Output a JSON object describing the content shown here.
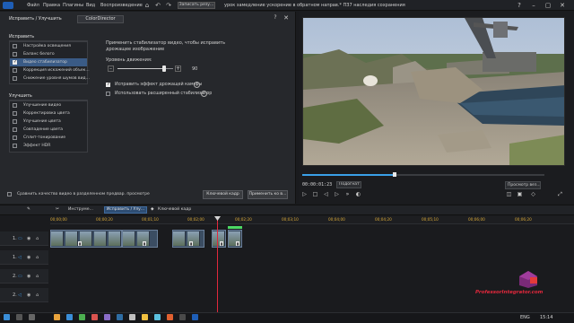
{
  "menubar": {
    "items": [
      "Файл",
      "Правка",
      "Плагины",
      "Вид",
      "Воспроизведение"
    ],
    "render_label": "Записать резу...",
    "doc_title": "урок замедление ускорение в обратном направ.*  ПЗ7 наследия сохранения"
  },
  "fix_panel": {
    "title": "Исправить / Улучшить",
    "colordirector_tab": "ColorDirector",
    "fix_header": "Исправить",
    "fix_items": [
      {
        "label": "Настройка освещения",
        "checked": false
      },
      {
        "label": "Баланс белого",
        "checked": false
      },
      {
        "label": "Видео стабилизатор",
        "checked": true
      },
      {
        "label": "Коррекция искажений объек...",
        "checked": false
      },
      {
        "label": "Снижение уровня шумов вид...",
        "checked": false
      }
    ],
    "enhance_header": "Улучшить",
    "enhance_items": [
      {
        "label": "Улучшение видео",
        "checked": false
      },
      {
        "label": "Корректировка цвета",
        "checked": false
      },
      {
        "label": "Улучшение цвета",
        "checked": false
      },
      {
        "label": "Совпадение цвета",
        "checked": false
      },
      {
        "label": "Сплит-тонирование",
        "checked": false
      },
      {
        "label": "Эффект HDR",
        "checked": false
      }
    ],
    "description": "Применить стабилизатор видео, чтобы исправить дрожащее изображение",
    "motion_label": "Уровень движения:",
    "motion_value": "90",
    "options": [
      {
        "label": "Исправить эффект дрожащей камеры",
        "checked": true
      },
      {
        "label": "Использовать расширенный стабилизатор",
        "checked": false
      }
    ],
    "compare_label": "Сравнить качество видео в разделенном предвар. просмотре",
    "keyframe_label": "Ключевой кадр",
    "apply_label": "Применить ко в..."
  },
  "preview": {
    "timecode": "00:00:01:23",
    "fit_label": "Подогнат",
    "quality_label": "Просмотр вез..."
  },
  "timeline": {
    "toolbar": {
      "tools_label": "Инструме...",
      "fix_label": "Исправить / Улу...",
      "keyframe_label": "Ключевой кадр"
    },
    "ticks": [
      "00;00;00",
      "00;00;20",
      "00;01;10",
      "00;02;00",
      "00;02;20",
      "00;03;10",
      "00;04;00",
      "00;04;20",
      "00;05;10",
      "00;06;00",
      "00;06;20"
    ],
    "tracks": [
      "1.",
      "1.",
      "2.",
      "2."
    ]
  },
  "watermark": "ProfessorIntegrator.com",
  "taskbar": {
    "lang": "ENG",
    "time": "15:14"
  },
  "colors": {
    "accent": "#3a5b86",
    "playhead": "#e0283c",
    "scrub": "#3aa0e8"
  }
}
